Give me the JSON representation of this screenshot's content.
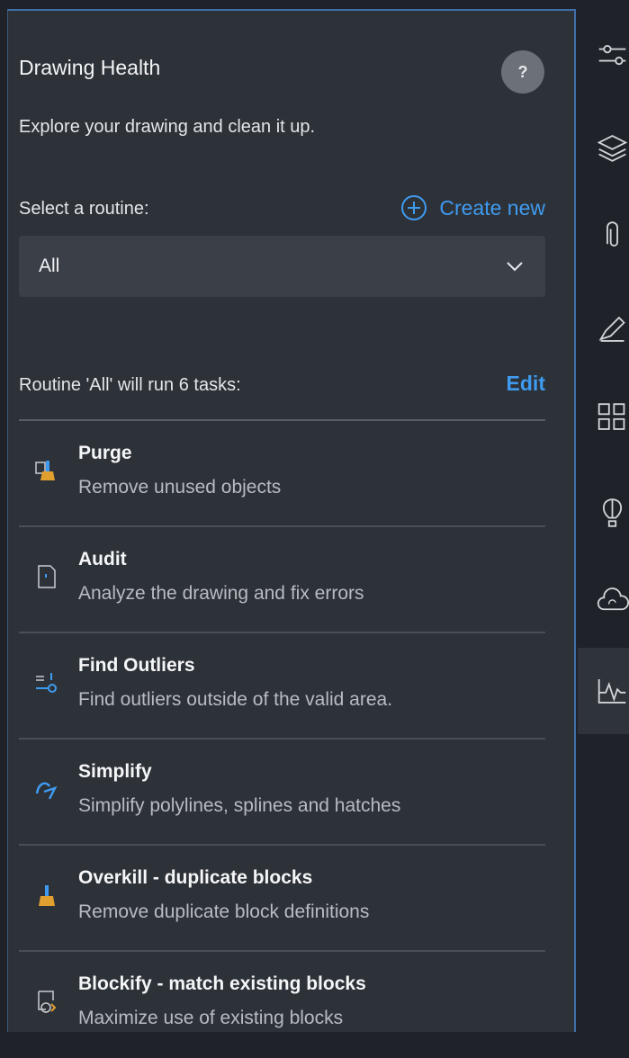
{
  "panel": {
    "title": "Drawing Health",
    "help_label": "?",
    "subtitle": "Explore your drawing and clean it up.",
    "select_label": "Select a routine:",
    "create_new_label": "Create new",
    "dropdown_value": "All",
    "routine_summary": "Routine 'All' will run 6 tasks:",
    "edit_label": "Edit"
  },
  "tasks": [
    {
      "title": "Purge",
      "description": "Remove unused objects",
      "icon": "purge-broom-icon"
    },
    {
      "title": "Audit",
      "description": "Analyze the drawing and fix errors",
      "icon": "audit-document-icon"
    },
    {
      "title": "Find Outliers",
      "description": "Find outliers outside of the valid area.",
      "icon": "find-outliers-icon"
    },
    {
      "title": "Simplify",
      "description": "Simplify polylines, splines and hatches",
      "icon": "simplify-curve-icon"
    },
    {
      "title": "Overkill - duplicate blocks",
      "description": "Remove duplicate block definitions",
      "icon": "overkill-broom-icon"
    },
    {
      "title": "Blockify - match existing blocks",
      "description": "Maximize use of existing blocks",
      "icon": "blockify-icon"
    }
  ],
  "rail": [
    {
      "icon": "properties-sliders-icon"
    },
    {
      "icon": "layers-icon"
    },
    {
      "icon": "attachments-clip-icon"
    },
    {
      "icon": "markup-pencil-icon"
    },
    {
      "icon": "blocks-grid-icon"
    },
    {
      "icon": "hot-air-balloon-icon"
    },
    {
      "icon": "cloud-sync-icon"
    },
    {
      "icon": "drawing-health-pulse-icon",
      "active": true
    }
  ],
  "colors": {
    "accent": "#3f9bf0",
    "panel_bg": "#2d3138",
    "rail_bg": "#1f2228",
    "dropdown_bg": "#3b3f47"
  }
}
